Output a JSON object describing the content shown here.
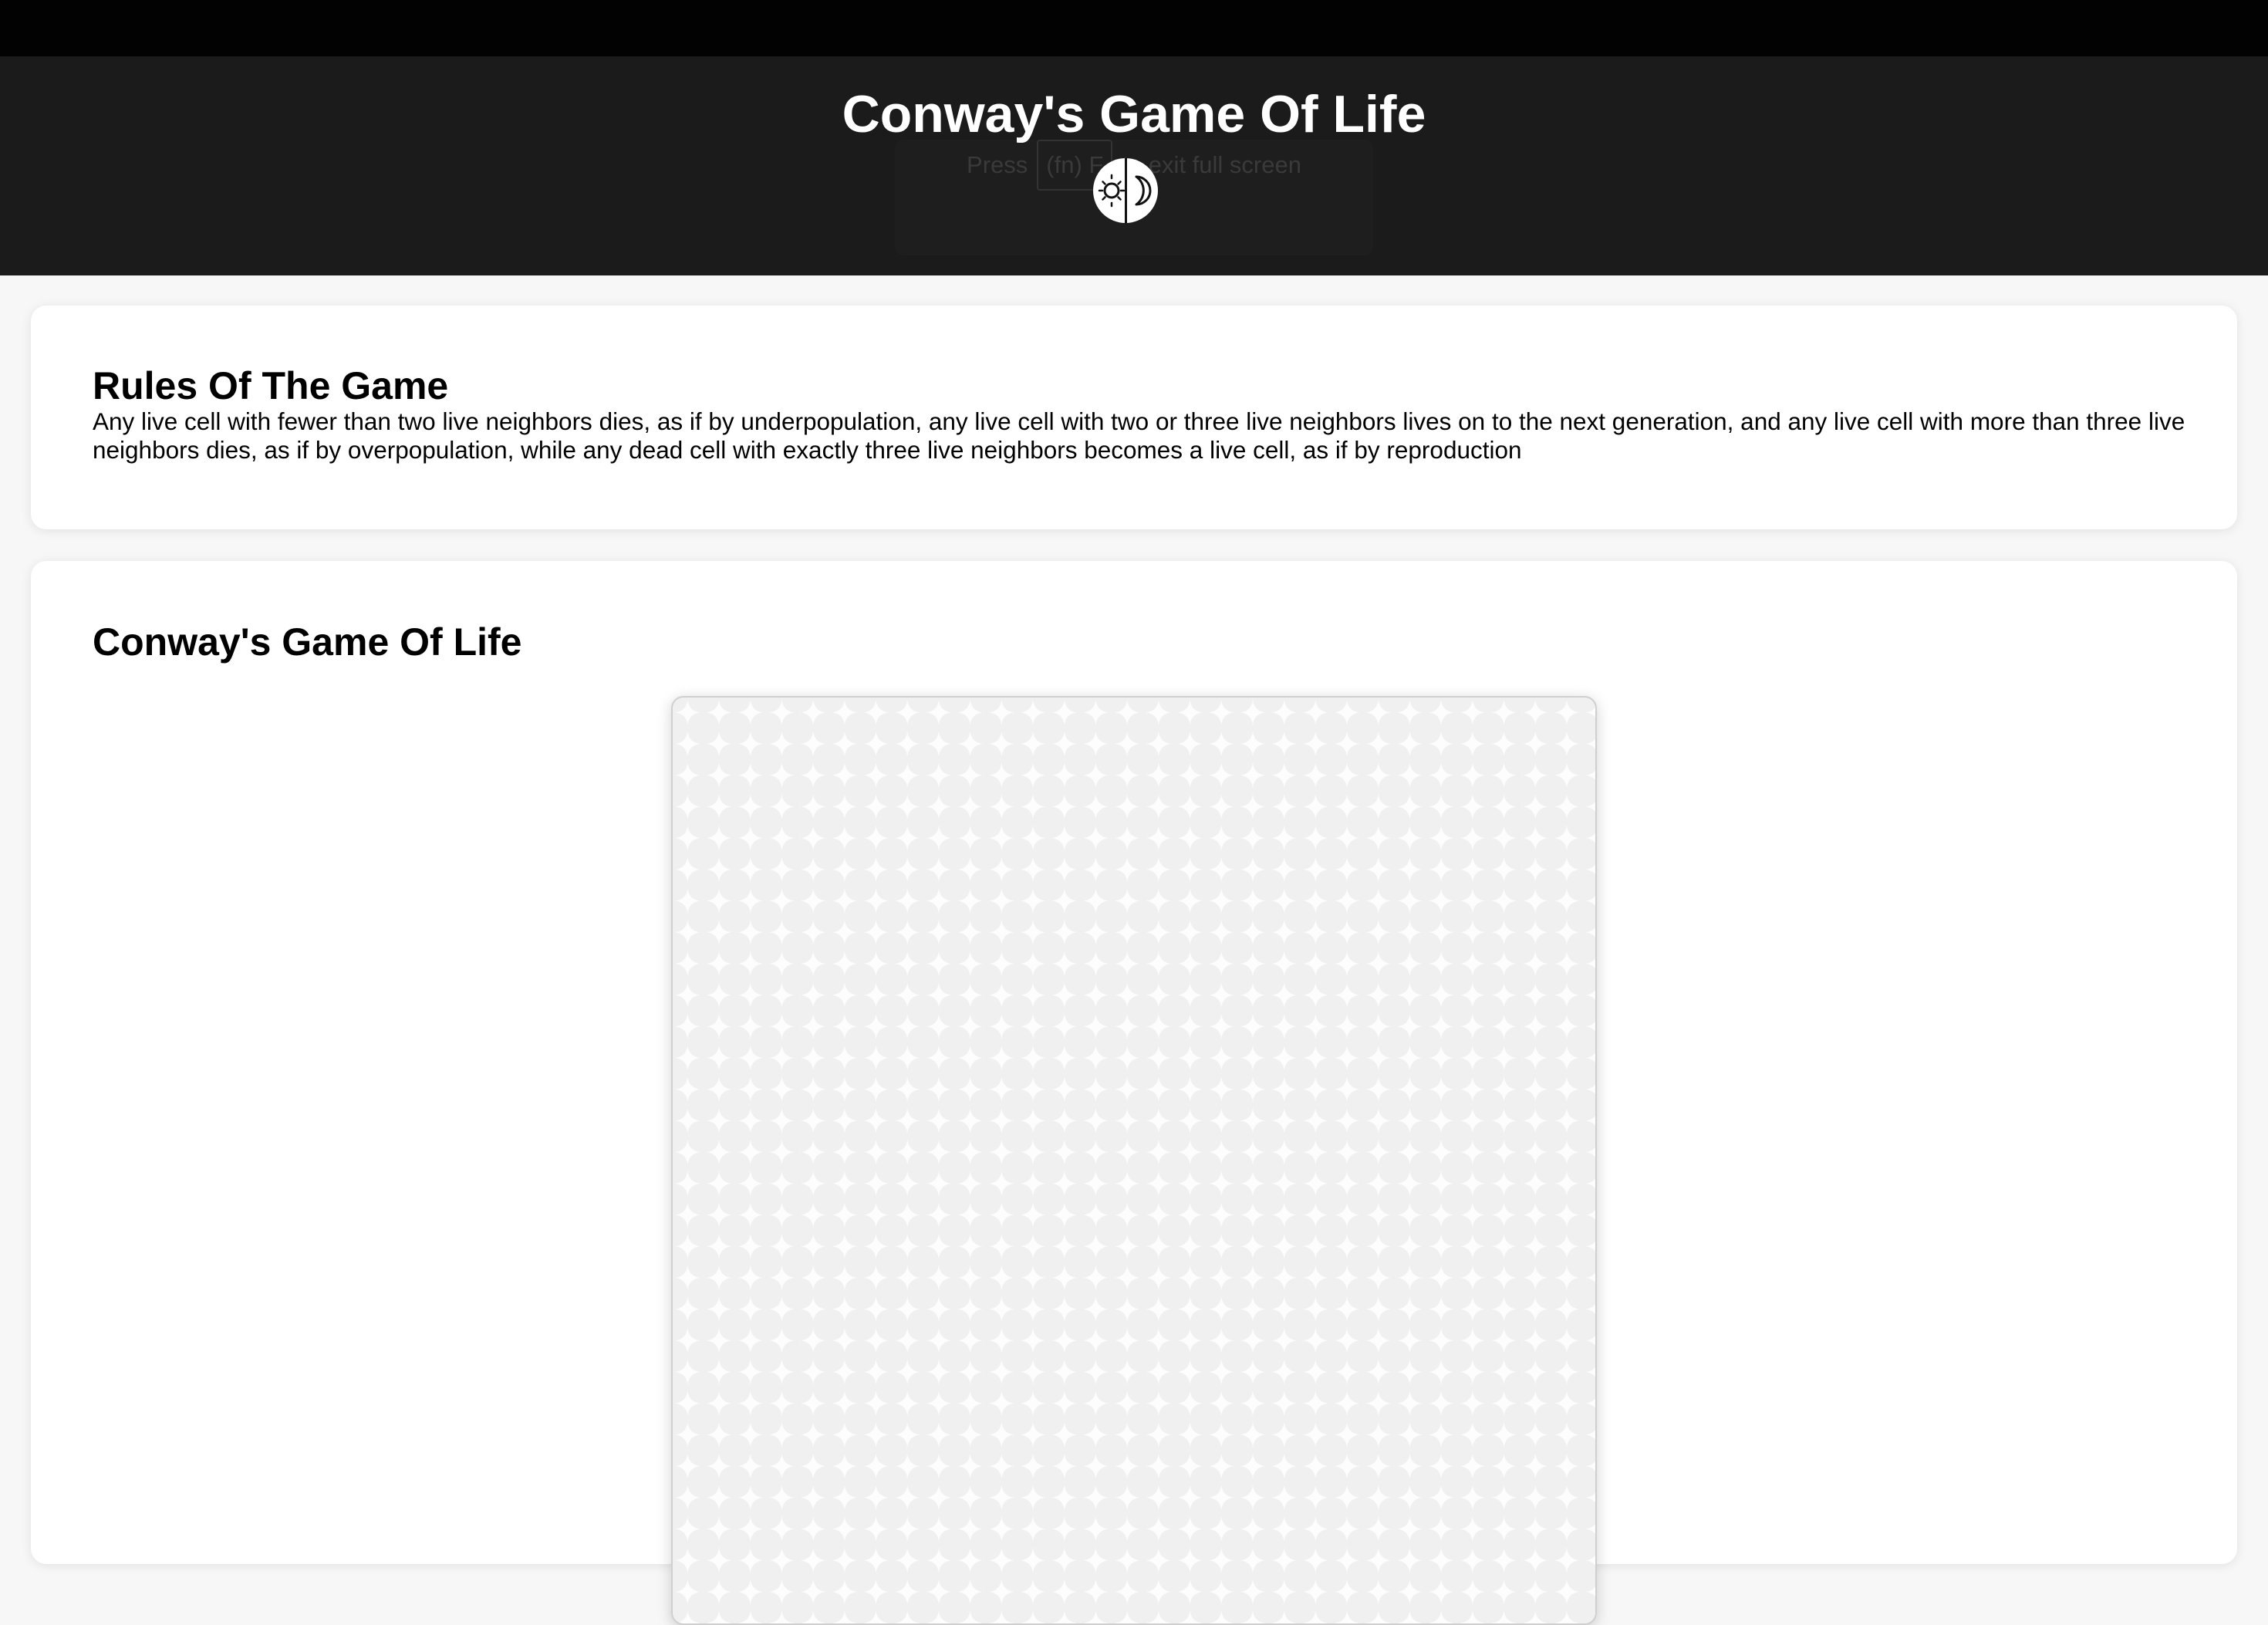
{
  "header": {
    "title": "Conway's Game Of Life",
    "fullscreen_hint": {
      "prefix": "Press",
      "key": "(fn) F",
      "suffix": "to exit full screen"
    },
    "theme_toggle": {
      "icons": [
        "sun-icon",
        "moon-icon"
      ]
    }
  },
  "rules": {
    "title": "Rules Of The Game",
    "text": "Any live cell with fewer than two live neighbors dies, as if by underpopulation, any live cell with two or three live neighbors lives on to the next generation, and any live cell with more than three live neighbors dies, as if by overpopulation, while any dead cell with exactly three live neighbors becomes a live cell, as if by reproduction"
  },
  "game": {
    "title": "Conway's Game Of Life"
  },
  "colors": {
    "topbar": "#020202",
    "header_bg": "#1b1b1b",
    "page_bg": "#f7f7f7",
    "card_bg": "#ffffff",
    "board_bg": "#f0f0f0",
    "cell_pattern": "#ffffff"
  }
}
